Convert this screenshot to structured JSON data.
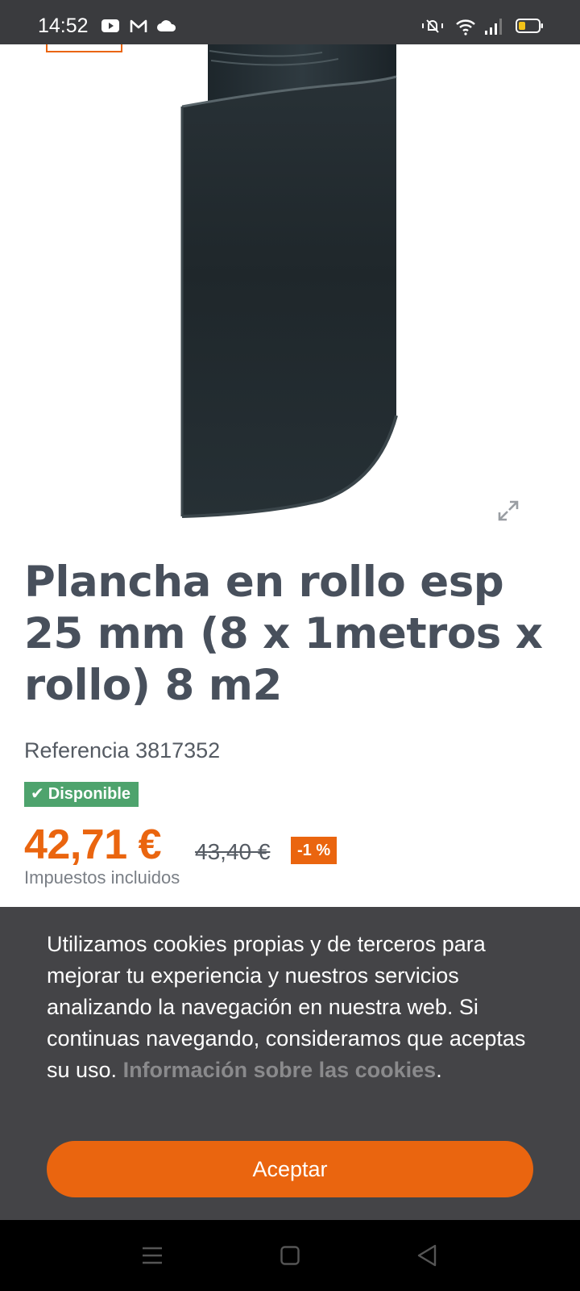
{
  "status_bar": {
    "time": "14:52",
    "left_icons": [
      "youtube-icon",
      "gmail-icon",
      "cloud-icon"
    ],
    "right_icons": [
      "mute-vibrate-icon",
      "wifi-icon",
      "signal-icon",
      "battery-icon"
    ]
  },
  "product": {
    "image": "foam-roll",
    "title": "Plancha en rollo esp 25 mm (8 x 1metros x rollo) 8 m2",
    "reference_label": "Referencia 3817352",
    "availability": "Disponible",
    "price": "42,71 €",
    "old_price": "43,40 €",
    "discount": "-1 %",
    "taxes_note": "Impuestos incluidos"
  },
  "cookie_banner": {
    "text": "Utilizamos cookies propias y de terceros para mejorar tu experiencia y nuestros servicios analizando la navegación en nuestra web. Si continuas navegando, consideramos que aceptas su uso. ",
    "link_text": "Información sobre las cookies",
    "trailing": ".",
    "accept_label": "Aceptar"
  },
  "nav_bar": {
    "buttons": [
      "menu-icon",
      "home-icon",
      "back-icon"
    ]
  },
  "colors": {
    "accent": "#ea650f",
    "available": "#4ea36d",
    "banner_bg": "#444447",
    "status_bg": "#3a3b3e"
  }
}
